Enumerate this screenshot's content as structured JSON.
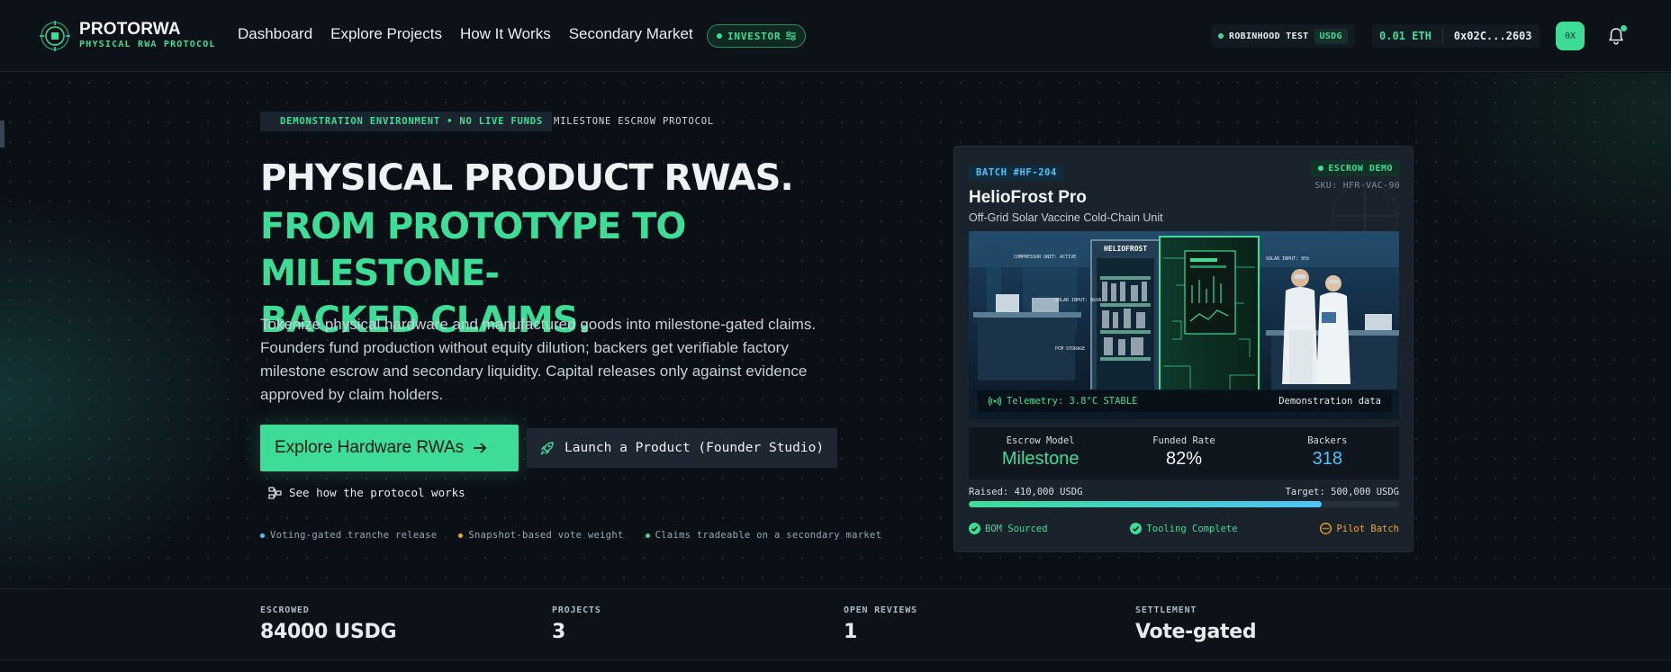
{
  "brand": {
    "name": "PROTORWA",
    "subtitle": "PHYSICAL RWA PROTOCOL"
  },
  "nav": {
    "links": [
      "Dashboard",
      "Explore Projects",
      "How It Works",
      "Secondary Market"
    ],
    "role_badge": "INVESTOR",
    "network_label": "ROBINHOOD TEST",
    "network_token": "USDG",
    "eth_balance": "0.01 ETH",
    "wallet_address": "0x02C...2603",
    "avatar_initials": "0X"
  },
  "hero": {
    "env_tag": "DEMONSTRATION ENVIRONMENT • NO LIVE FUNDS",
    "env_tag_suffix": "MILESTONE ESCROW PROTOCOL",
    "headline_line1": "PHYSICAL PRODUCT RWAS.",
    "headline_line2": "FROM PROTOTYPE TO MILESTONE-",
    "headline_line3": "BACKED CLAIMS.",
    "description": "Tokenize physical hardware and manufactured goods into milestone-gated claims. Founders fund production without equity dilution; backers get verifiable factory milestone escrow and secondary liquidity. Capital releases only against evidence approved by claim holders.",
    "primary_cta": "Explore Hardware RWAs",
    "secondary_cta": "Launch a Product (Founder Studio)",
    "how_link": "See how the protocol works",
    "features": [
      {
        "label": "Voting-gated tranche release",
        "color": "#4fc3f7"
      },
      {
        "label": "Snapshot-based vote weight",
        "color": "#f5a623"
      },
      {
        "label": "Claims tradeable on a secondary market",
        "color": "#3ddc97"
      }
    ]
  },
  "card": {
    "batch": "BATCH #HF-204",
    "status": "ESCROW DEMO",
    "sku": "SKU: HFR-VAC-90",
    "product_name": "HelioFrost Pro",
    "product_subtitle": "Off-Grid Solar Vaccine Cold-Chain Unit",
    "telemetry": "Telemetry: 3.8°C STABLE",
    "demo_note": "Demonstration data",
    "image_labels": [
      "COMPRESSOR UNIT: ACTIVE",
      "HELIOFROST",
      "SOLAR INPUT: 95%",
      "SOLAR INPUT: 8kVA",
      "PCM STORAGE"
    ],
    "stats": [
      {
        "label": "Escrow Model",
        "value": "Milestone",
        "color": "#3ddc97"
      },
      {
        "label": "Funded Rate",
        "value": "82%",
        "color": "#f2f5f7"
      },
      {
        "label": "Backers",
        "value": "318",
        "color": "#4fc3f7"
      }
    ],
    "raised": "Raised: 410,000 USDG",
    "target": "Target: 500,000 USDG",
    "progress_fraction": 0.82,
    "milestones": [
      {
        "label": "BOM Sourced",
        "state": "done",
        "color": "#3ddc97"
      },
      {
        "label": "Tooling Complete",
        "state": "done",
        "color": "#3ddc97"
      },
      {
        "label": "Pilot Batch",
        "state": "pending",
        "color": "#f5a623"
      }
    ]
  },
  "band": [
    {
      "label": "ESCROWED",
      "value": "84000 USDG"
    },
    {
      "label": "PROJECTS",
      "value": "3"
    },
    {
      "label": "OPEN REVIEWS",
      "value": "1"
    },
    {
      "label": "SETTLEMENT",
      "value": "Vote-gated"
    }
  ]
}
